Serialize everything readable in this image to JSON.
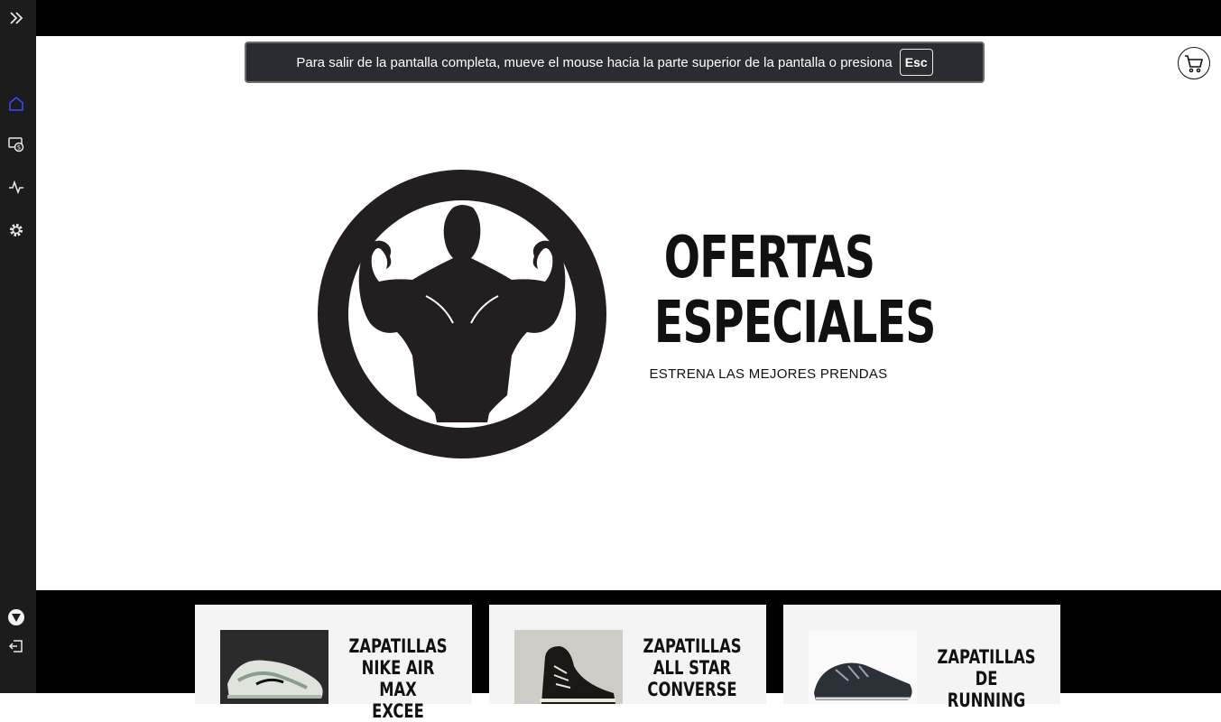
{
  "notice": {
    "text": "Para salir de la pantalla completa, mueve el mouse hacia la parte superior de la pantalla o presiona",
    "key": "Esc"
  },
  "sidebar": {
    "items": [
      {
        "icon": "home-icon",
        "active": true
      },
      {
        "icon": "money-icon",
        "active": false
      },
      {
        "icon": "activity-icon",
        "active": false
      },
      {
        "icon": "gear-icon",
        "active": false
      }
    ],
    "bottom": [
      {
        "icon": "brand-logo-icon"
      },
      {
        "icon": "logout-icon"
      }
    ]
  },
  "header": {
    "cart_icon": "cart-icon"
  },
  "hero": {
    "title_line1": "OFERTAS",
    "title_line2": "ESPECIALES",
    "subtitle": "ESTRENA LAS MEJORES PRENDAS"
  },
  "products": [
    {
      "title_line1": "ZAPATILLAS",
      "title_line2": "NIKE AIR MAX",
      "title_line3": "EXCEE"
    },
    {
      "title_line1": "ZAPATILLAS",
      "title_line2": "ALL STAR",
      "title_line3": "CONVERSE"
    },
    {
      "title_line1": "ZAPATILLAS DE",
      "title_line2": "RUNNING",
      "title_line3": ""
    }
  ],
  "colors": {
    "sidebar": "#1c1c1c",
    "active_icon": "#3b4bff",
    "top_bar": "#000000",
    "card_bg": "#f4f4f4"
  }
}
